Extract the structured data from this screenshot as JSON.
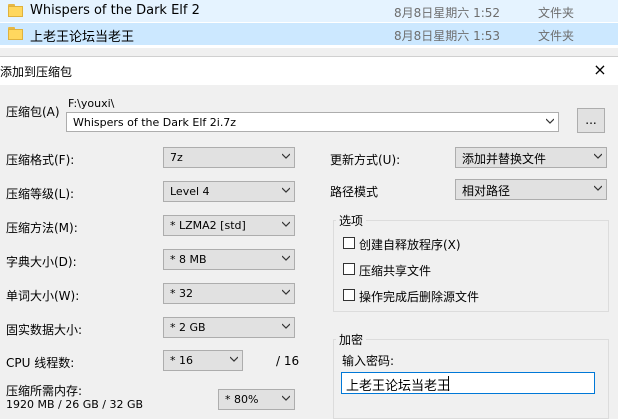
{
  "files": [
    {
      "name": "Whispers of the Dark Elf 2",
      "date": "8月8日星期六 1:52",
      "type": "文件夹"
    },
    {
      "name": "上老王论坛当老王",
      "date": "8月8日星期六 1:53",
      "type": "文件夹"
    }
  ],
  "dialog": {
    "title": "添加到压缩包",
    "close": "×",
    "archive": {
      "label": "压缩包(A)",
      "path": "F:\\youxi\\",
      "name": "Whispers of the Dark Elf 2i.7z",
      "browse": "..."
    },
    "format": {
      "label": "压缩格式(F):",
      "value": "7z"
    },
    "level": {
      "label": "压缩等级(L):",
      "value": "Level 4"
    },
    "method": {
      "label": "压缩方法(M):",
      "value": "*  LZMA2 [std]"
    },
    "dict": {
      "label": "字典大小(D):",
      "value": "*  8 MB"
    },
    "word": {
      "label": "单词大小(W):",
      "value": "*  32"
    },
    "solid": {
      "label": "固实数据大小:",
      "value": "*  2 GB"
    },
    "threads": {
      "label": "CPU 线程数:",
      "value": "*  16",
      "max": "/ 16"
    },
    "memory": {
      "label": "压缩所需内存:",
      "info": "1920 MB / 26 GB / 32 GB",
      "value": "* 80%"
    },
    "update": {
      "label": "更新方式(U):",
      "value": "添加并替换文件"
    },
    "pathmode": {
      "label": "路径模式",
      "value": "相对路径"
    },
    "options": {
      "title": "选项",
      "sfx": "创建自释放程序(X)",
      "shared": "压缩共享文件",
      "delete": "操作完成后删除源文件"
    },
    "encryption": {
      "title": "加密",
      "label": "输入密码:",
      "value": "上老王论坛当老王"
    }
  }
}
